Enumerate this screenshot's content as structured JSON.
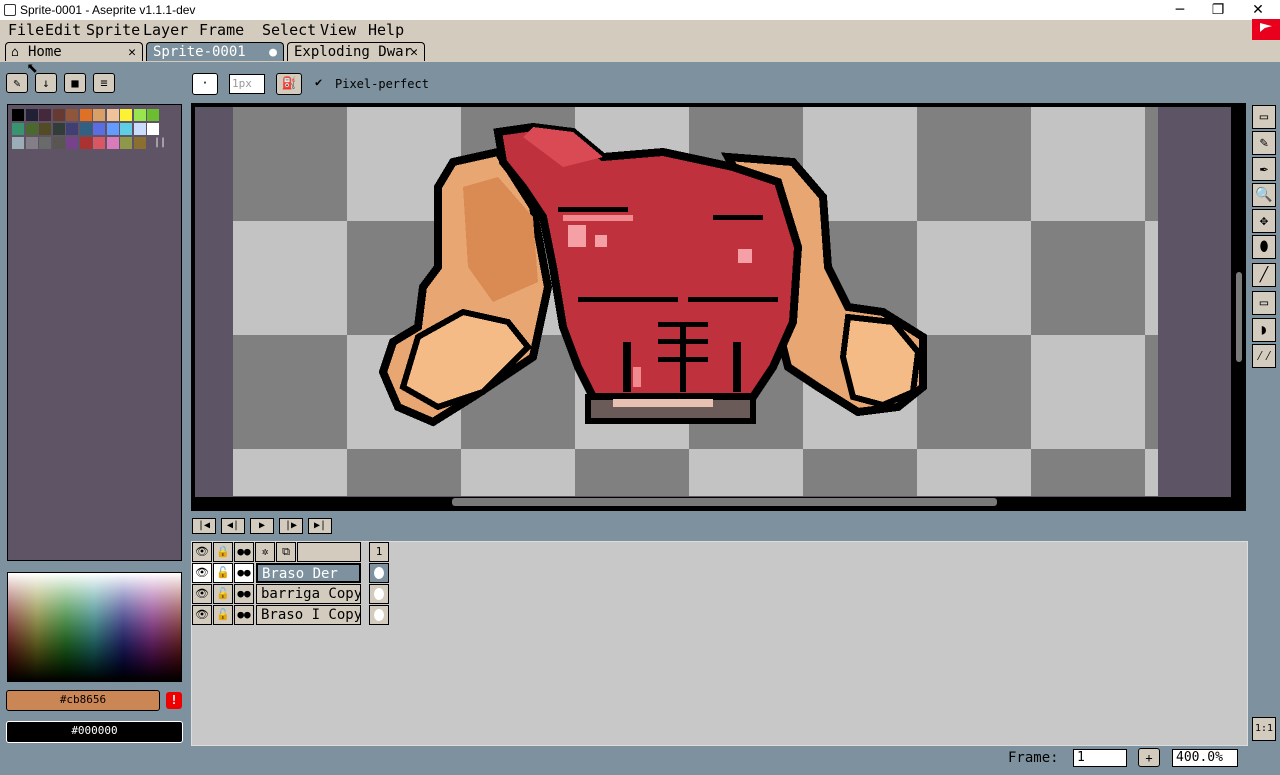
{
  "window": {
    "title": "Sprite-0001 - Aseprite v1.1.1-dev",
    "minimize_glyph": "─",
    "restore_glyph": "❐",
    "close_glyph": "✕"
  },
  "menu": [
    "File",
    "Edit",
    "Sprite",
    "Layer",
    "Frame",
    "Select",
    "View",
    "Help"
  ],
  "tabs": [
    {
      "label": "Home",
      "close": "✕"
    },
    {
      "label": "Sprite-0001",
      "close": "●"
    },
    {
      "label": "Exploding Dwar",
      "close": "✕"
    }
  ],
  "toolbar": {
    "brush_size": "1px",
    "pixel_perfect_label": "Pixel-perfect",
    "pixel_perfect_checked": true
  },
  "palette": {
    "colors": [
      "#000000",
      "#222034",
      "#45283c",
      "#663931",
      "#8f563b",
      "#df7126",
      "#d9a066",
      "#eec39a",
      "#fbf236",
      "#99e550",
      "#6abe30",
      "#37946e",
      "#4b692f",
      "#524b24",
      "#323c39",
      "#3f3f74",
      "#306082",
      "#5b6ee1",
      "#639bff",
      "#5fcde4",
      "#cbdbfc",
      "#ffffff",
      "#9badb7",
      "#847e87",
      "#696a6a",
      "#595652",
      "#76428a",
      "#ac3232",
      "#d95763",
      "#d77bba",
      "#8f974a",
      "#8a6f30"
    ]
  },
  "colors": {
    "foreground": "#cb8656",
    "foreground_label": "#cb8656",
    "background": "#000000",
    "background_label": "#000000",
    "warning_glyph": "!"
  },
  "tools": [
    "▭",
    "✎",
    "✒",
    "🔍",
    "✥",
    "⬮",
    "╱",
    "▭",
    "◗",
    "⁄⁄"
  ],
  "playback": [
    "|◀",
    "◀|",
    "▶",
    "|▶",
    "▶|"
  ],
  "timeline": {
    "header_icons": [
      "👁",
      "🔒",
      "●●",
      "✲",
      "⧉"
    ],
    "frame_number": "1",
    "layers": [
      {
        "name": "Braso Der",
        "selected": true
      },
      {
        "name": "barriga Copy (",
        "selected": false
      },
      {
        "name": "Braso I Copy",
        "selected": false
      }
    ]
  },
  "status": {
    "frame_label": "Frame:",
    "frame_value": "1",
    "add_frame": "+",
    "zoom": "400.0%",
    "one_to_one": "1:1"
  }
}
